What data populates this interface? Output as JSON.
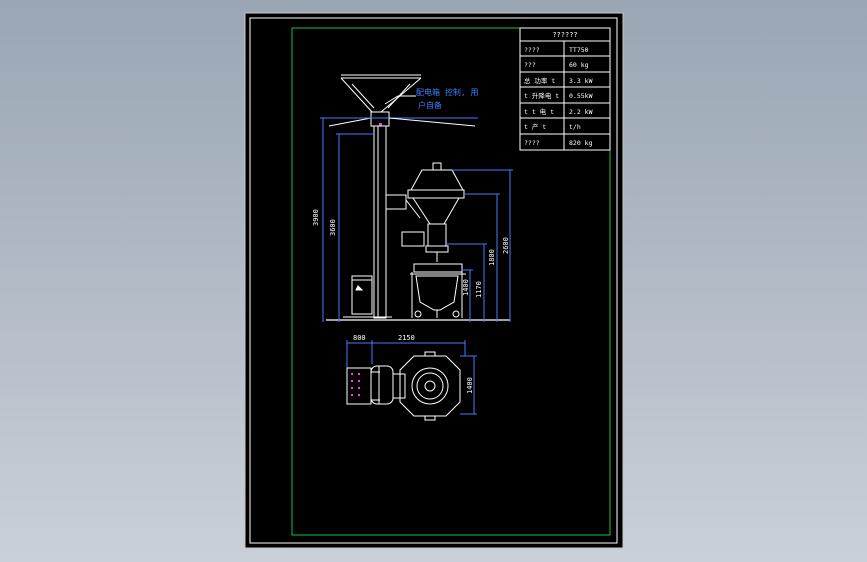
{
  "drawing": {
    "annotation": {
      "line1": "配电箱 控制, 用",
      "line2": "户自备"
    },
    "title_block": {
      "header": "??????",
      "rows": [
        {
          "label": "????",
          "value": "TT750"
        },
        {
          "label": "???",
          "value": "60 kg"
        },
        {
          "label": "总 功率 t",
          "value": "3.3 kW"
        },
        {
          "label": "t 升降电 t",
          "value": "0.55kW"
        },
        {
          "label": "t t 电 t",
          "value": "2.2 kW"
        },
        {
          "label": "t 产 t",
          "value": "t/h"
        },
        {
          "label": "????",
          "value": "820 kg"
        }
      ]
    },
    "dimensions": {
      "height_outer": "3900",
      "height_column": "3600",
      "right_total": "2600",
      "right_mid": "1800",
      "right_low": "1170",
      "right_small": "1400",
      "plan_left": "800",
      "plan_span": "2150",
      "plan_depth": "1400"
    },
    "colors": {
      "canvas": "#000000",
      "linework": "#ffffff",
      "dimension": "#3f7dff",
      "frame": "#18c23a",
      "accent": "#ff3bd2"
    }
  }
}
